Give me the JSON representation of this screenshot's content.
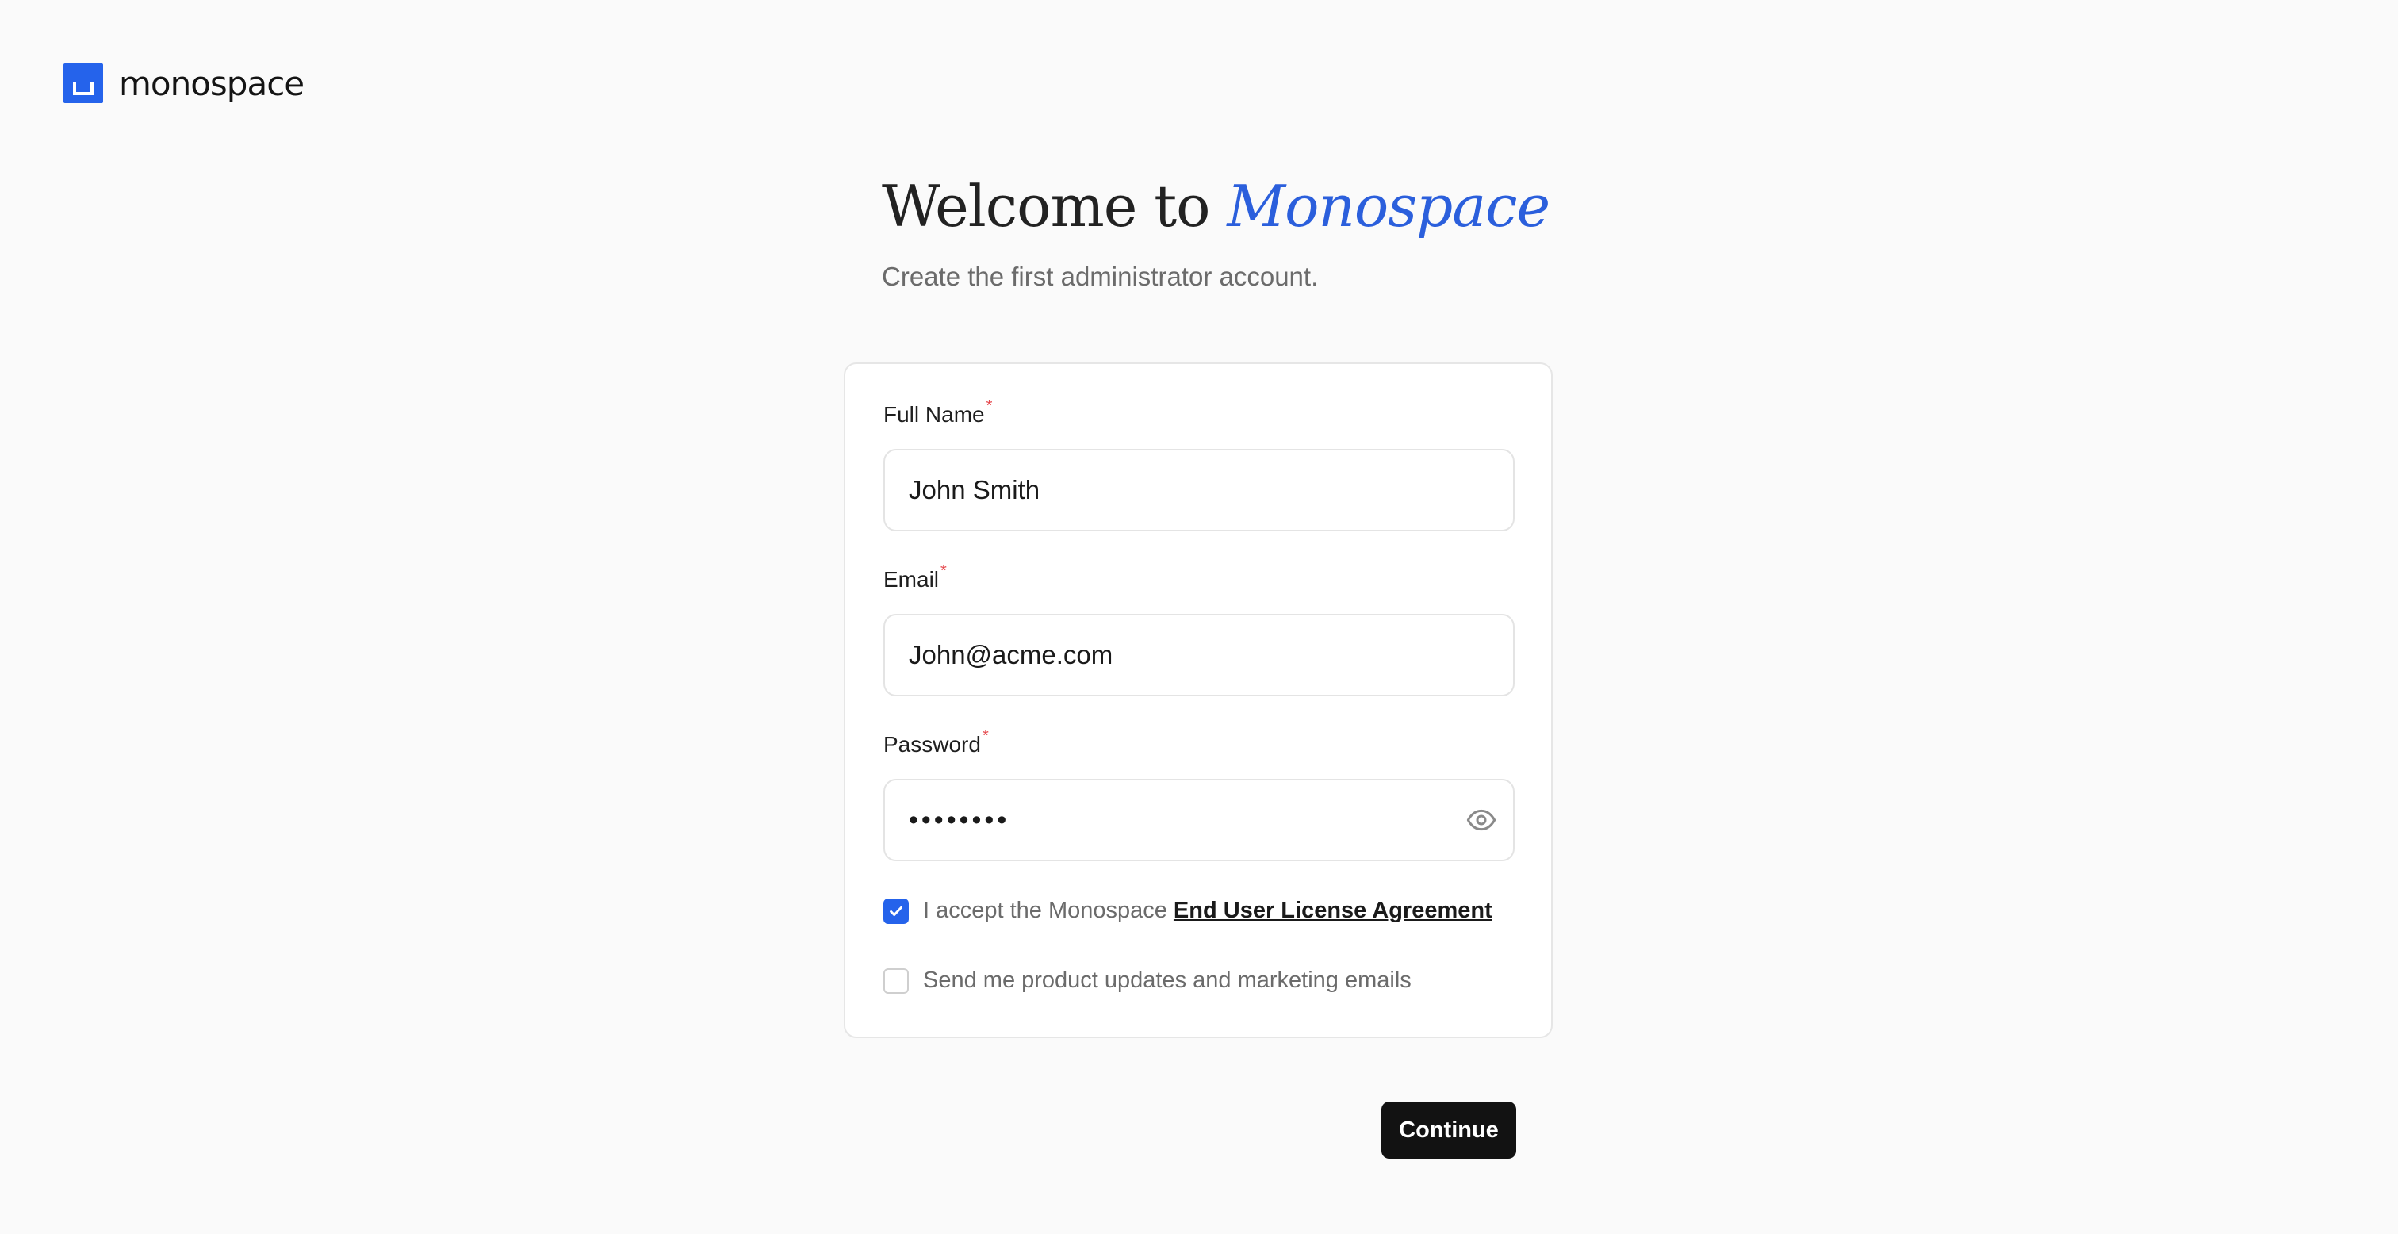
{
  "brand": {
    "name": "monospace",
    "color": "#2563eb",
    "icon": "monospace-logo-icon"
  },
  "header": {
    "title_prefix": "Welcome to",
    "title_accent": "Monospace",
    "subtitle": "Create the first administrator account."
  },
  "form": {
    "full_name": {
      "label": "Full Name",
      "required_mark": "*",
      "value": "John Smith"
    },
    "email": {
      "label": "Email",
      "required_mark": "*",
      "value": "John@acme.com"
    },
    "password": {
      "label": "Password",
      "required_mark": "*",
      "masked_value": "••••••••",
      "toggle_icon": "eye-icon"
    },
    "eula": {
      "checked": true,
      "text": "I accept the Monospace",
      "link_text": "End User License Agreement"
    },
    "marketing": {
      "checked": false,
      "text": "Send me product updates and marketing emails"
    }
  },
  "actions": {
    "continue_label": "Continue"
  },
  "colors": {
    "accent": "#2b5fdc",
    "required": "#e5484d",
    "button_bg": "#121212",
    "page_bg": "#fafafa"
  }
}
